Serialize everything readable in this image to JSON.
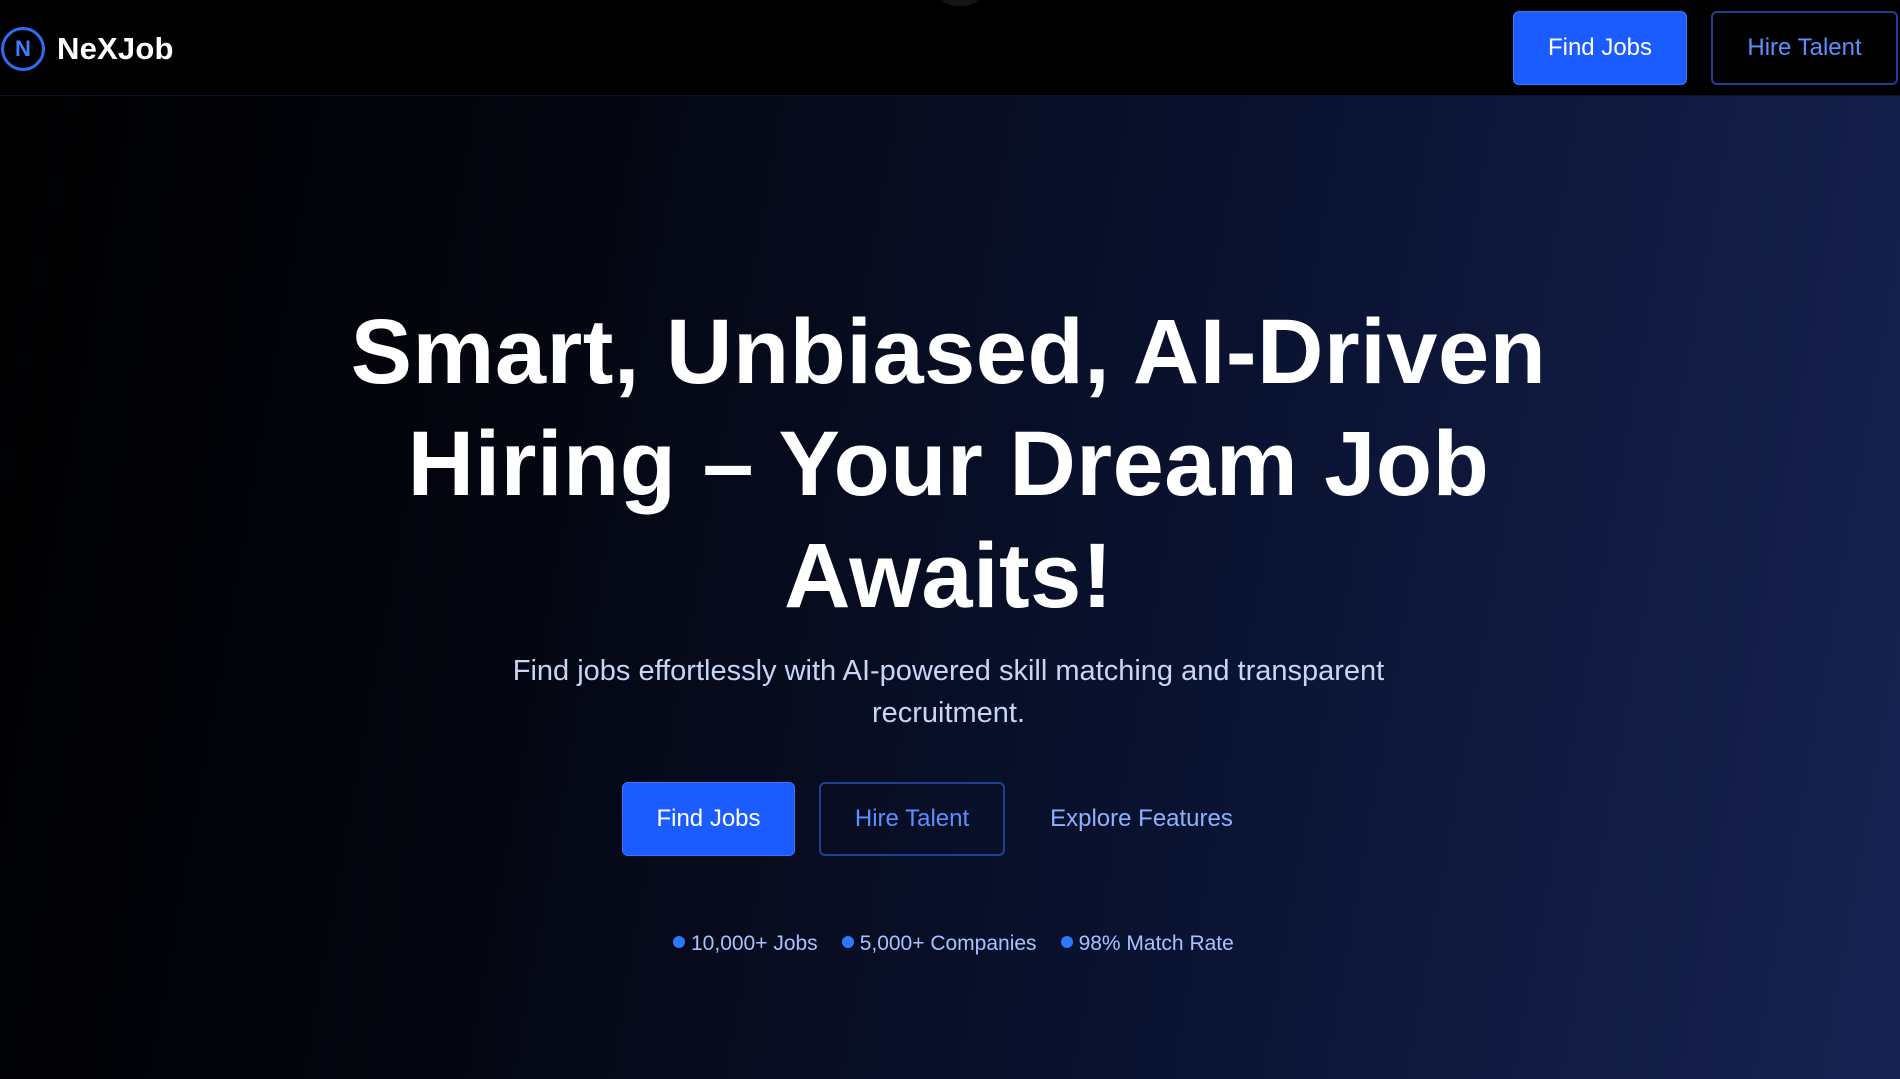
{
  "brand": {
    "logo_letter": "N",
    "name": "NeXJob"
  },
  "nav": {
    "find_jobs": "Find Jobs",
    "hire_talent": "Hire Talent"
  },
  "hero": {
    "headline_line1": "Smart, Unbiased, AI-Driven",
    "headline_line2": "Hiring – Your Dream Job",
    "headline_line3": "Awaits!",
    "subtitle_line1": "Find jobs effortlessly with AI-powered skill matching and transparent",
    "subtitle_line2": "recruitment.",
    "cta_find_jobs": "Find Jobs",
    "cta_hire_talent": "Hire Talent",
    "cta_explore": "Explore Features",
    "stats": [
      {
        "label": "10,000+ Jobs"
      },
      {
        "label": "5,000+ Companies"
      },
      {
        "label": "98% Match Rate"
      }
    ]
  },
  "colors": {
    "accent": "#1a5cff",
    "accent_text": "#5b90ff",
    "background": "#000000",
    "gradient_end": "#172352"
  }
}
